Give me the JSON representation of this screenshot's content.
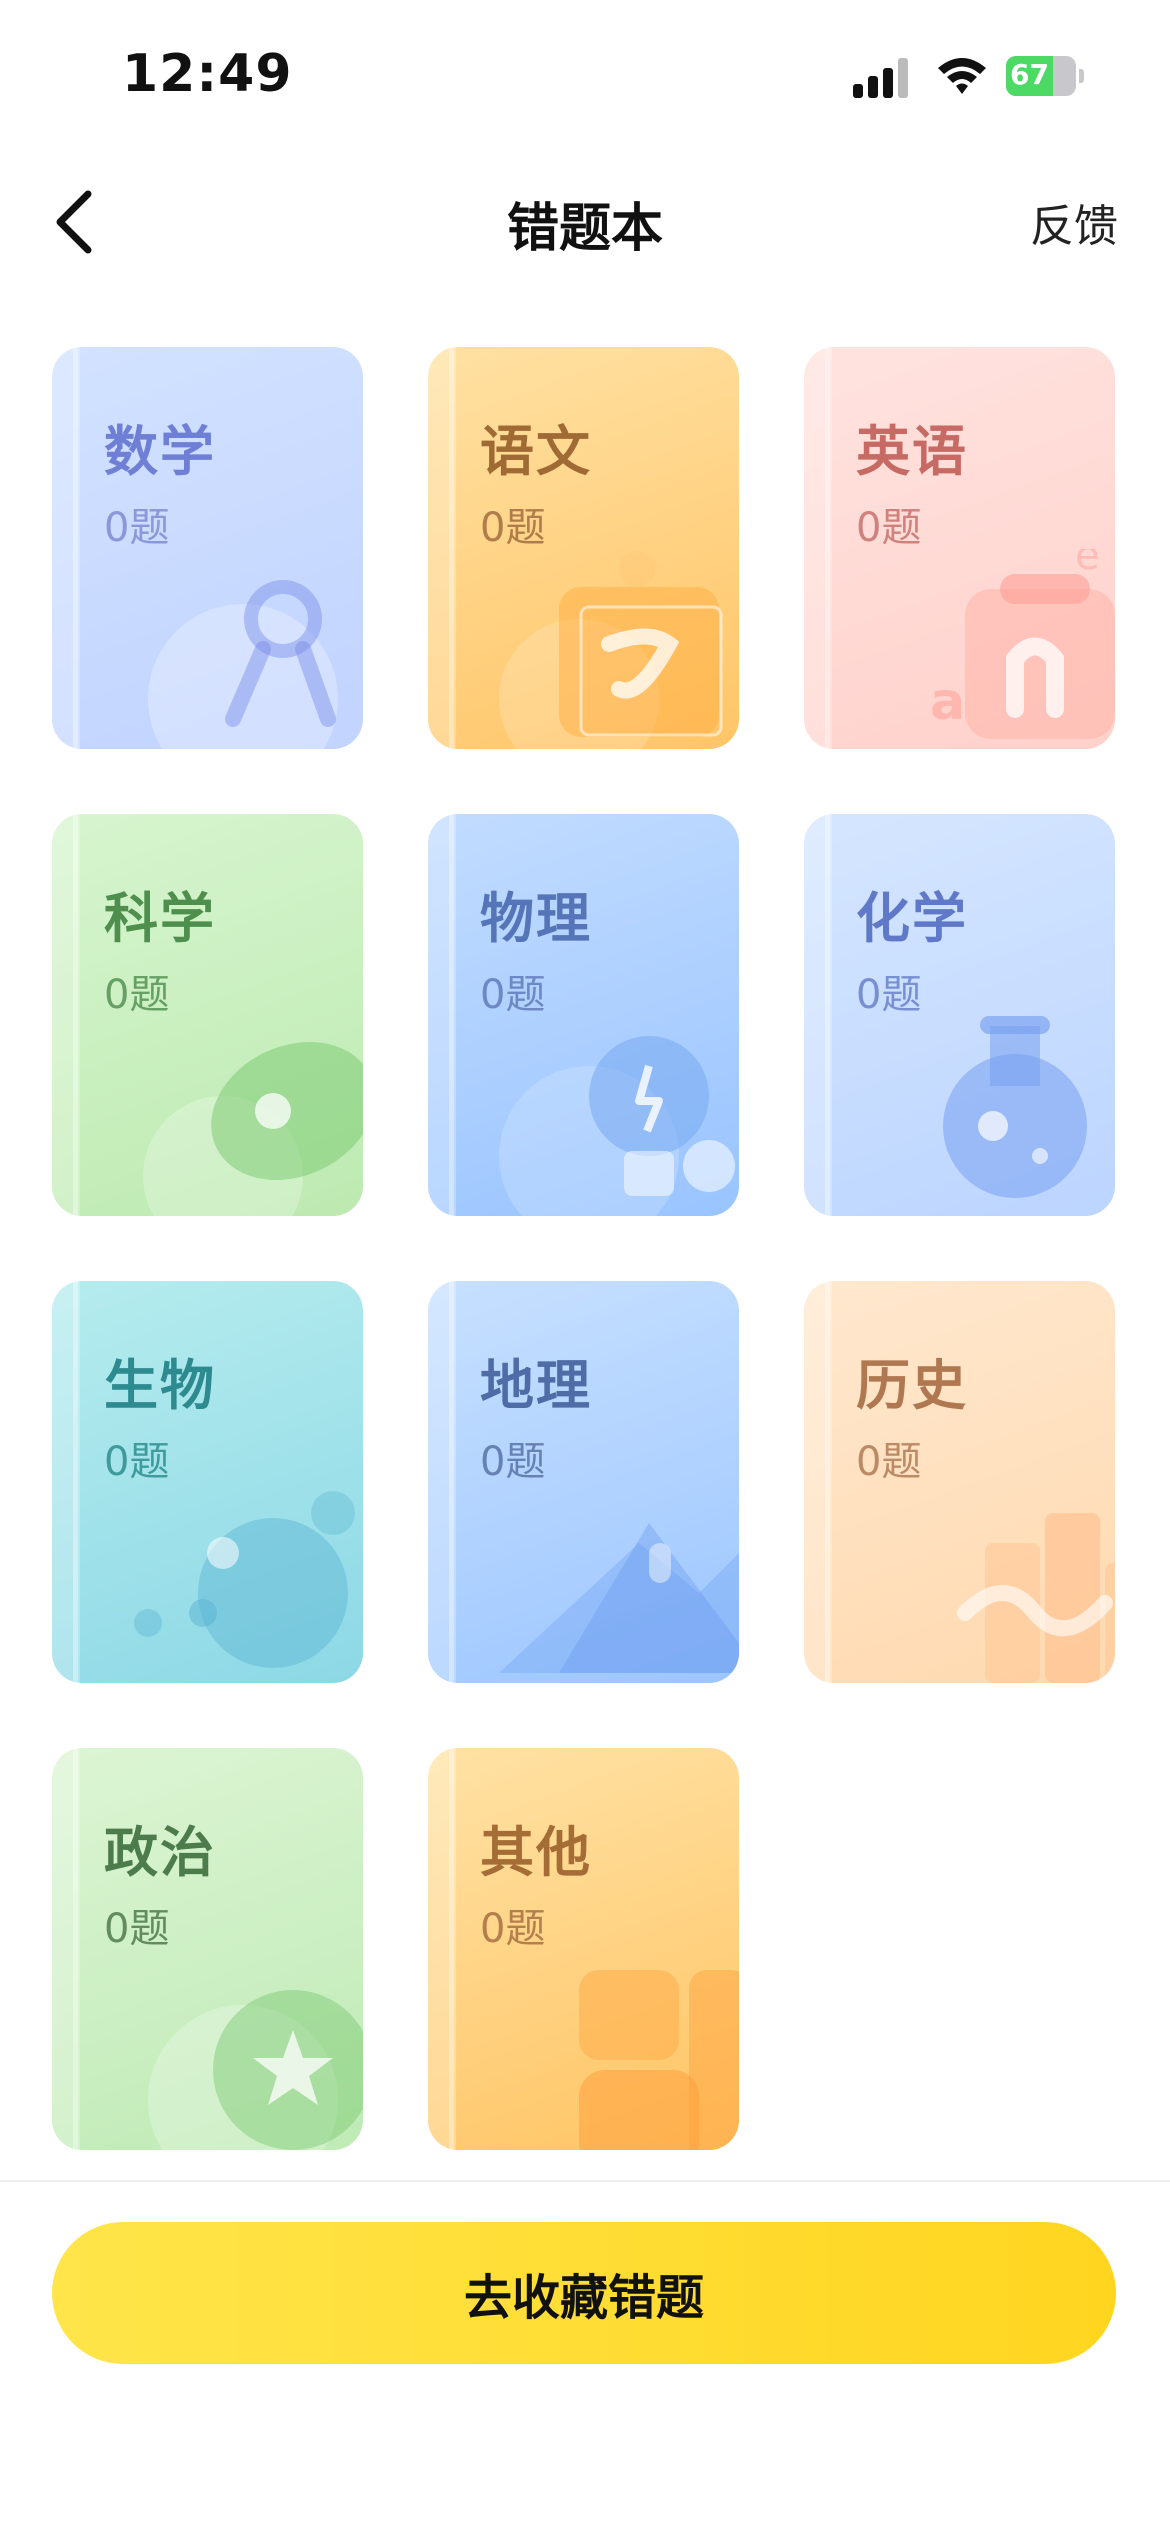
{
  "status": {
    "time": "12:49",
    "battery": "67",
    "battery_level": 0.67
  },
  "nav": {
    "title": "错题本",
    "feedback": "反馈"
  },
  "subjects": [
    {
      "name": "数学",
      "count": "0题",
      "icon": "compass-icon",
      "bg": [
        "#d2e2ff",
        "#c1d3ff"
      ],
      "text_color": "#6f7fd6",
      "count_color": "#8a97d8"
    },
    {
      "name": "语文",
      "count": "0题",
      "icon": "brush-stroke-icon",
      "bg": [
        "#ffe1a3",
        "#ffc567"
      ],
      "text_color": "#a06a35",
      "count_color": "#b07c49"
    },
    {
      "name": "英语",
      "count": "0题",
      "icon": "letters-icon",
      "bg": [
        "#ffe3df",
        "#ffd1cb"
      ],
      "text_color": "#c76a64",
      "count_color": "#cf817b"
    },
    {
      "name": "科学",
      "count": "0题",
      "icon": "planet-icon",
      "bg": [
        "#d7f5cf",
        "#bdeab1"
      ],
      "text_color": "#4f8f4e",
      "count_color": "#66a064"
    },
    {
      "name": "物理",
      "count": "0题",
      "icon": "bulb-icon",
      "bg": [
        "#c2dcff",
        "#99c4ff"
      ],
      "text_color": "#5674b8",
      "count_color": "#6d88c4"
    },
    {
      "name": "化学",
      "count": "0题",
      "icon": "flask-icon",
      "bg": [
        "#d5e6ff",
        "#bcd5ff"
      ],
      "text_color": "#5f79c8",
      "count_color": "#7890d2"
    },
    {
      "name": "生物",
      "count": "0题",
      "icon": "cell-icon",
      "bg": [
        "#b5ecee",
        "#8dd8e6"
      ],
      "text_color": "#2d8b8f",
      "count_color": "#3f9a9c"
    },
    {
      "name": "地理",
      "count": "0题",
      "icon": "mountain-icon",
      "bg": [
        "#c7e0ff",
        "#9cc6ff"
      ],
      "text_color": "#4f6ca6",
      "count_color": "#6781b4"
    },
    {
      "name": "历史",
      "count": "0题",
      "icon": "columns-icon",
      "bg": [
        "#ffe8cf",
        "#ffd9af"
      ],
      "text_color": "#b07851",
      "count_color": "#bd8a66"
    },
    {
      "name": "政治",
      "count": "0题",
      "icon": "star-badge-icon",
      "bg": [
        "#dcf5d4",
        "#bfeab5"
      ],
      "text_color": "#4d7c4c",
      "count_color": "#628c60"
    },
    {
      "name": "其他",
      "count": "0题",
      "icon": "blocks-icon",
      "bg": [
        "#ffe2a5",
        "#ffc463"
      ],
      "text_color": "#a66c36",
      "count_color": "#b47f4d"
    }
  ],
  "cta": {
    "label": "去收藏错题"
  }
}
